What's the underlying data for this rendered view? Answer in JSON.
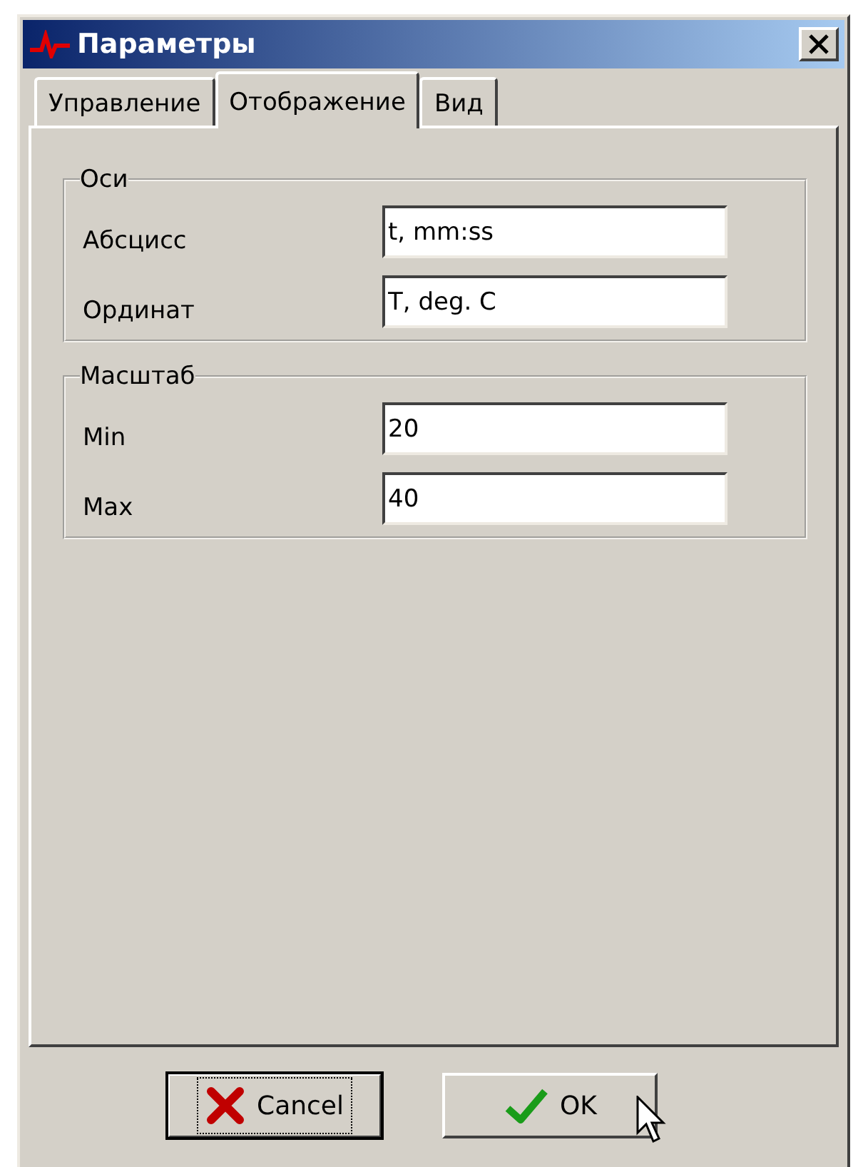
{
  "window": {
    "title": "Параметры"
  },
  "tabs": [
    {
      "label": "Управление",
      "selected": false
    },
    {
      "label": "Отображение",
      "selected": true
    },
    {
      "label": "Вид",
      "selected": false
    }
  ],
  "groups": [
    {
      "title": "Оси",
      "fields": [
        {
          "label": "Абсцисс",
          "value": "t, mm:ss"
        },
        {
          "label": "Ординат",
          "value": "T, deg. C"
        }
      ]
    },
    {
      "title": "Масштаб",
      "fields": [
        {
          "label": "Min",
          "value": "20"
        },
        {
          "label": "Max",
          "value": "40"
        }
      ]
    }
  ],
  "buttons": [
    {
      "label": "Cancel",
      "kind": "cancel",
      "focused": true
    },
    {
      "label": "OK",
      "kind": "ok",
      "focused": false
    }
  ]
}
